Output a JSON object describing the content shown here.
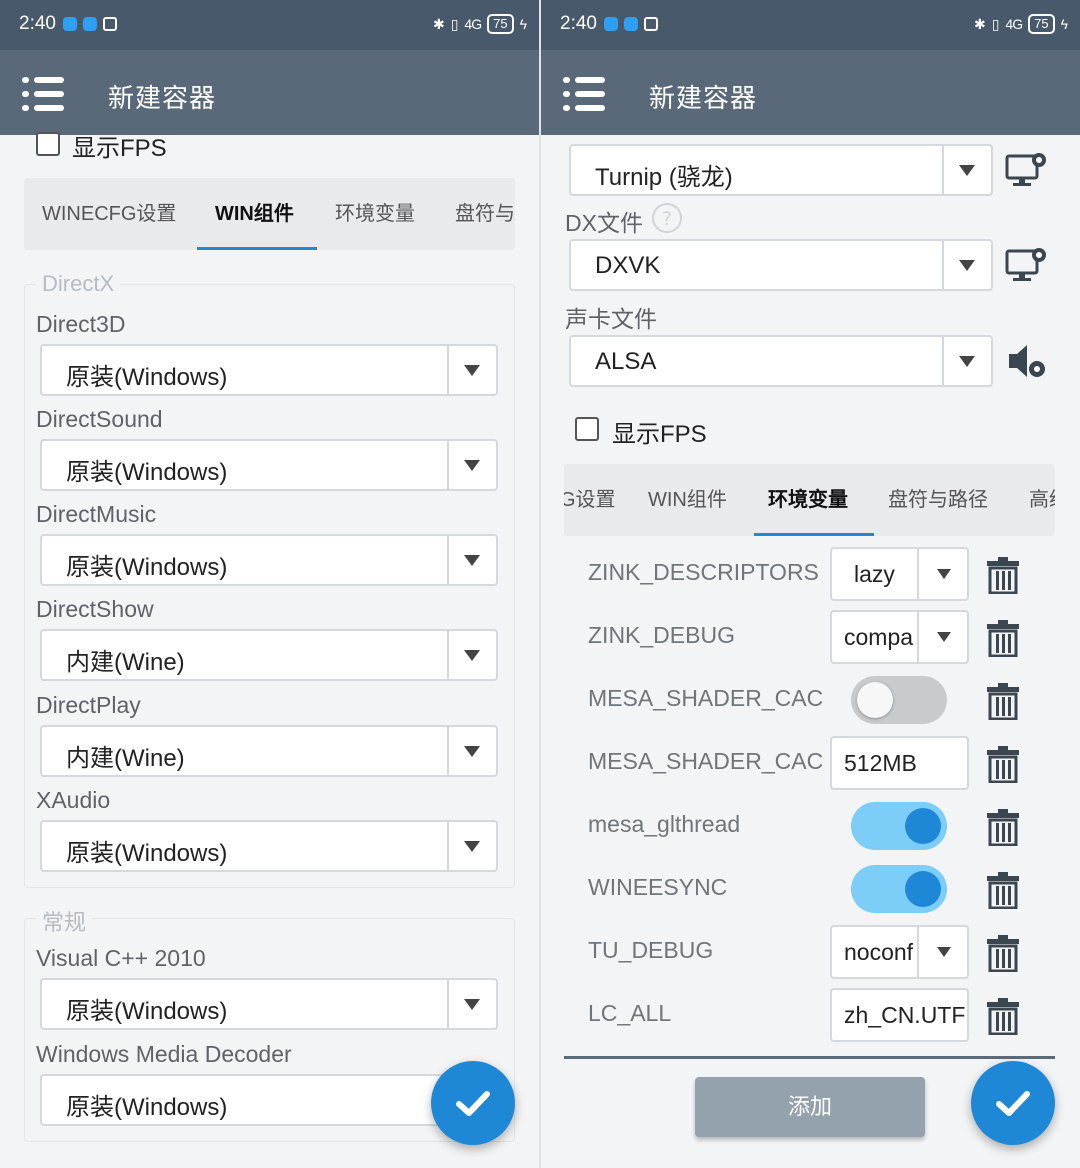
{
  "left": {
    "status": {
      "time": "2:40",
      "battery": "75",
      "signal": "4G"
    },
    "appbar": {
      "title": "新建容器"
    },
    "show_fps": {
      "label": "显示FPS",
      "checked": false
    },
    "tabs": [
      "WINECFG设置",
      "WIN组件",
      "环境变量",
      "盘符与"
    ],
    "active_tab": "WIN组件",
    "directx": {
      "title": "DirectX",
      "fields": [
        {
          "label": "Direct3D",
          "value": "原装(Windows)"
        },
        {
          "label": "DirectSound",
          "value": "原装(Windows)"
        },
        {
          "label": "DirectMusic",
          "value": "原装(Windows)"
        },
        {
          "label": "DirectShow",
          "value": "内建(Wine)"
        },
        {
          "label": "DirectPlay",
          "value": "内建(Wine)"
        },
        {
          "label": "XAudio",
          "value": "原装(Windows)"
        }
      ]
    },
    "general": {
      "title": "常规",
      "fields": [
        {
          "label": "Visual C++ 2010",
          "value": "原装(Windows)"
        },
        {
          "label": "Windows Media Decoder",
          "value": "原装(Windows)"
        }
      ]
    }
  },
  "right": {
    "status": {
      "time": "2:40",
      "battery": "75",
      "signal": "4G"
    },
    "appbar": {
      "title": "新建容器"
    },
    "driver_select": {
      "value": "Turnip (骁龙)"
    },
    "dx": {
      "label": "DX文件",
      "value": "DXVK"
    },
    "sound": {
      "label": "声卡文件",
      "value": "ALSA"
    },
    "show_fps": {
      "label": "显示FPS",
      "checked": false
    },
    "tabs": [
      "G设置",
      "WIN组件",
      "环境变量",
      "盘符与路径",
      "高级"
    ],
    "active_tab": "环境变量",
    "env_vars": [
      {
        "name": "ZINK_DESCRIPTORS",
        "type": "select",
        "value": "lazy"
      },
      {
        "name": "ZINK_DEBUG",
        "type": "select",
        "value": "compa"
      },
      {
        "name": "MESA_SHADER_CAC",
        "type": "toggle",
        "on": false
      },
      {
        "name": "MESA_SHADER_CAC",
        "type": "text",
        "value": "512MB"
      },
      {
        "name": "mesa_glthread",
        "type": "toggle",
        "on": true
      },
      {
        "name": "WINEESYNC",
        "type": "toggle",
        "on": true
      },
      {
        "name": "TU_DEBUG",
        "type": "select",
        "value": "noconf"
      },
      {
        "name": "LC_ALL",
        "type": "text",
        "value": "zh_CN.UTF"
      }
    ],
    "add_label": "添加"
  },
  "colors": {
    "appbar": "#59697a",
    "statusbar": "#47596a",
    "accent": "#1e88d6",
    "toggle_on": "#7ccdf7"
  }
}
